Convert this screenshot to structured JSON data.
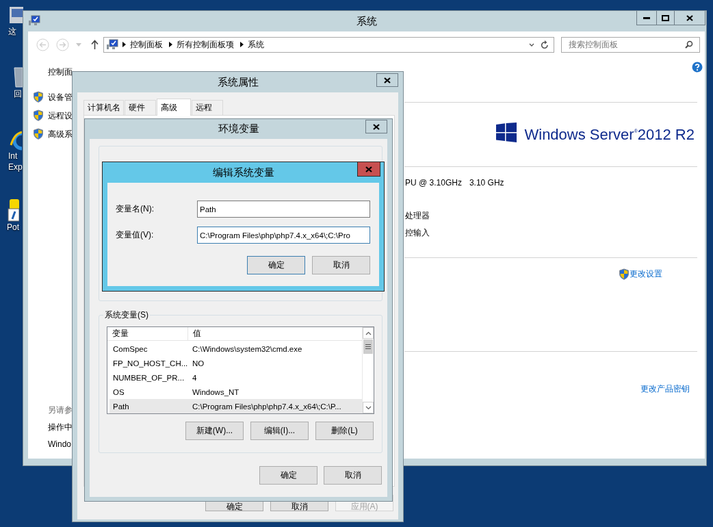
{
  "desktop_icons": [
    {
      "kind": "computer",
      "lines": [
        "这"
      ]
    },
    {
      "kind": "bin",
      "lines": [
        "回"
      ]
    },
    {
      "kind": "browser",
      "lines": [
        "Int",
        "Exp"
      ]
    },
    {
      "kind": "player",
      "lines": [
        "Pot"
      ]
    }
  ],
  "system_window": {
    "title": "系统",
    "address": [
      "控制面板",
      "所有控制面板项",
      "系统"
    ],
    "search": {
      "placeholder": "搜索控制面板"
    },
    "sidebar": {
      "home": "控制面",
      "links": [
        "设备管",
        "远程设",
        "高级系"
      ],
      "see_also_heading": "另请参",
      "see_also": [
        "操作中",
        "Windo"
      ]
    },
    "logo": {
      "brand": "Windows Server",
      "registered": "®",
      "version": "2012 R2"
    },
    "info_lines": [
      [
        "PU @ 3.10GHz",
        "3.10 GHz"
      ],
      [
        "处理器"
      ],
      [
        "控输入"
      ]
    ],
    "change_settings": "更改设置",
    "change_key": "更改产品密钥"
  },
  "system_properties": {
    "title": "系统属性",
    "tabs": [
      {
        "label": "计算机名",
        "selected": false
      },
      {
        "label": "硬件",
        "selected": false
      },
      {
        "label": "高级",
        "selected": true
      },
      {
        "label": "远程",
        "selected": false
      }
    ],
    "buttons": [
      {
        "label": "确定",
        "disabled": false
      },
      {
        "label": "取消",
        "disabled": false
      },
      {
        "label": "应用(A)",
        "disabled": true
      }
    ]
  },
  "environment_variables": {
    "title": "环境变量",
    "system_group": "系统变量(S)",
    "columns": [
      "变量",
      "值"
    ],
    "rows": [
      {
        "name": "ComSpec",
        "value": "C:\\Windows\\system32\\cmd.exe",
        "selected": false
      },
      {
        "name": "FP_NO_HOST_CH...",
        "value": "NO",
        "selected": false
      },
      {
        "name": "NUMBER_OF_PR...",
        "value": "4",
        "selected": false
      },
      {
        "name": "OS",
        "value": "Windows_NT",
        "selected": false
      },
      {
        "name": "Path",
        "value": "C:\\Program Files\\php\\php7.4.x_x64\\;C:\\P...",
        "selected": true
      }
    ],
    "list_buttons": [
      "新建(W)...",
      "编辑(I)...",
      "删除(L)"
    ],
    "buttons": [
      "确定",
      "取消"
    ]
  },
  "edit_dialog": {
    "title": "编辑系统变量",
    "active": true,
    "fields": [
      {
        "label": "变量名(N):",
        "value": "Path",
        "focused": false
      },
      {
        "label": "变量值(V):",
        "value": "C:\\Program Files\\php\\php7.4.x_x64\\;C:\\Pro",
        "focused": true
      }
    ],
    "buttons": [
      {
        "label": "确定",
        "default": true
      },
      {
        "label": "取消",
        "default": false
      }
    ]
  }
}
